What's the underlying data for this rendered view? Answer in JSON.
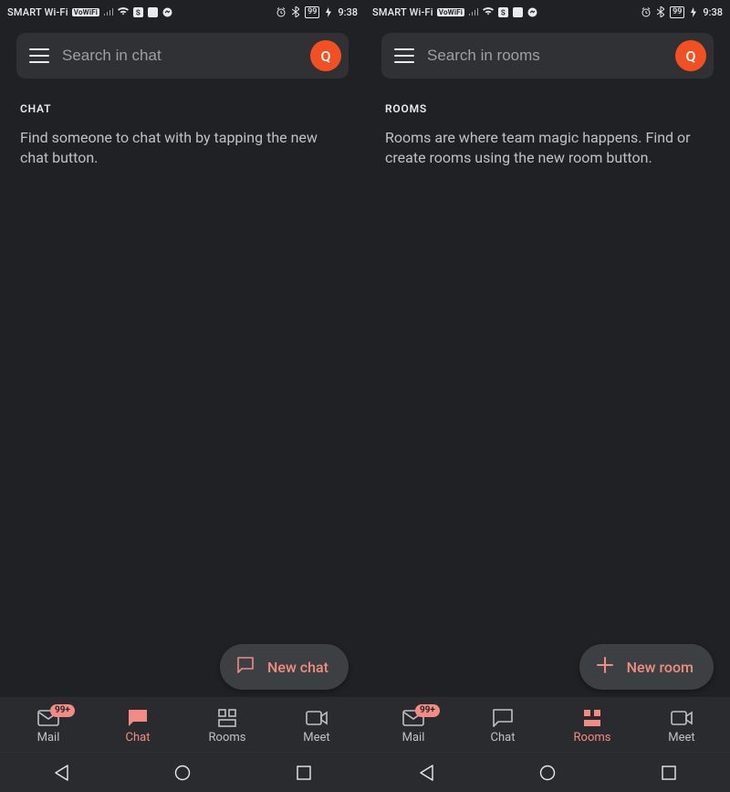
{
  "status": {
    "carrier": "SMART Wi-Fi",
    "vowifi": "VoWiFi",
    "battery": "99",
    "time": "9:38"
  },
  "avatar_initial": "Q",
  "screens": [
    {
      "search_placeholder": "Search in chat",
      "section_label": "CHAT",
      "empty_text": "Find someone to chat with by tapping the new chat button.",
      "fab_label": "New chat",
      "fab_icon": "chat",
      "active_tab": "Chat"
    },
    {
      "search_placeholder": "Search in rooms",
      "section_label": "ROOMS",
      "empty_text": "Rooms are where team magic happens. Find or create rooms using the new room button.",
      "fab_label": "New room",
      "fab_icon": "plus",
      "active_tab": "Rooms"
    }
  ],
  "nav": {
    "mail": "Mail",
    "chat": "Chat",
    "rooms": "Rooms",
    "meet": "Meet",
    "mail_badge": "99+"
  },
  "colors": {
    "accent": "#f28b82",
    "avatar": "#f25022"
  }
}
